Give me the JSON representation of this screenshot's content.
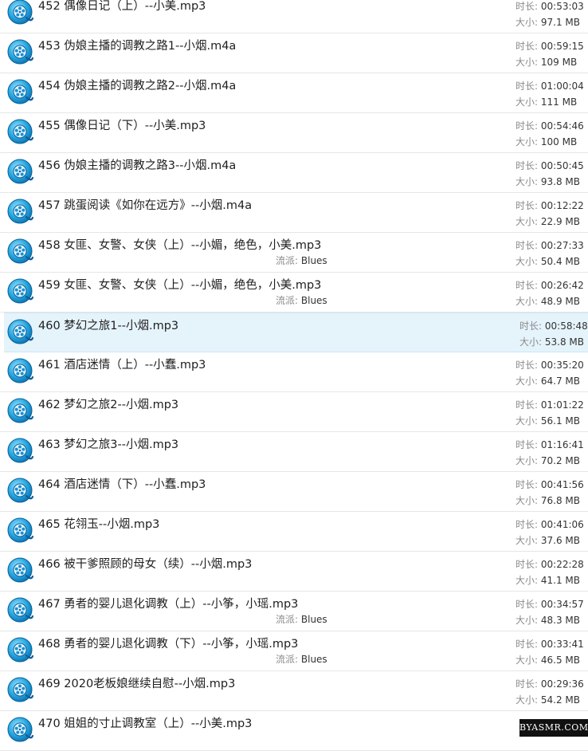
{
  "labels": {
    "duration": "时长:",
    "size": "大小:",
    "genre": "流派:"
  },
  "colors": {
    "selected_row": "#e5f3fb",
    "icon_primary": "#29a9e0",
    "icon_highlight": "#9ce4ff"
  },
  "icon": "media-player-icon",
  "items": [
    {
      "title": "452 偶像日记（上）--小美.mp3",
      "duration": "00:53:03",
      "size": "97.1 MB",
      "genre": "",
      "selected": false
    },
    {
      "title": "453 伪娘主播的调教之路1--小烟.m4a",
      "duration": "00:59:15",
      "size": "109 MB",
      "genre": "",
      "selected": false
    },
    {
      "title": "454 伪娘主播的调教之路2--小烟.m4a",
      "duration": "01:00:04",
      "size": "111 MB",
      "genre": "",
      "selected": false
    },
    {
      "title": "455 偶像日记（下）--小美.mp3",
      "duration": "00:54:46",
      "size": "100 MB",
      "genre": "",
      "selected": false
    },
    {
      "title": "456 伪娘主播的调教之路3--小烟.m4a",
      "duration": "00:50:45",
      "size": "93.8 MB",
      "genre": "",
      "selected": false
    },
    {
      "title": "457 跳蛋阅读《如你在远方》--小烟.m4a",
      "duration": "00:12:22",
      "size": "22.9 MB",
      "genre": "",
      "selected": false
    },
    {
      "title": "458 女匪、女警、女侠（上）--小媚，绝色，小美.mp3",
      "duration": "00:27:33",
      "size": "50.4 MB",
      "genre": "Blues",
      "selected": false
    },
    {
      "title": "459 女匪、女警、女侠（上）--小媚，绝色，小美.mp3",
      "duration": "00:26:42",
      "size": "48.9 MB",
      "genre": "Blues",
      "selected": false
    },
    {
      "title": "460 梦幻之旅1--小烟.mp3",
      "duration": "00:58:48",
      "size": "53.8 MB",
      "genre": "",
      "selected": true
    },
    {
      "title": "461 酒店迷情（上）--小蠢.mp3",
      "duration": "00:35:20",
      "size": "64.7 MB",
      "genre": "",
      "selected": false
    },
    {
      "title": "462 梦幻之旅2--小烟.mp3",
      "duration": "01:01:22",
      "size": "56.1 MB",
      "genre": "",
      "selected": false
    },
    {
      "title": "463 梦幻之旅3--小烟.mp3",
      "duration": "01:16:41",
      "size": "70.2 MB",
      "genre": "",
      "selected": false
    },
    {
      "title": "464 酒店迷情（下）--小蠢.mp3",
      "duration": "00:41:56",
      "size": "76.8 MB",
      "genre": "",
      "selected": false
    },
    {
      "title": "465 花翎玉--小烟.mp3",
      "duration": "00:41:06",
      "size": "37.6 MB",
      "genre": "",
      "selected": false
    },
    {
      "title": "466 被干爹照顾的母女（续）--小烟.mp3",
      "duration": "00:22:28",
      "size": "41.1 MB",
      "genre": "",
      "selected": false
    },
    {
      "title": "467 勇者的婴儿退化调教（上）--小筝，小瑶.mp3",
      "duration": "00:34:57",
      "size": "48.3 MB",
      "genre": "Blues",
      "selected": false
    },
    {
      "title": "468 勇者的婴儿退化调教（下）--小筝，小瑶.mp3",
      "duration": "00:33:41",
      "size": "46.5 MB",
      "genre": "Blues",
      "selected": false
    },
    {
      "title": "469 2020老板娘继续自慰--小烟.mp3",
      "duration": "00:29:36",
      "size": "54.2 MB",
      "genre": "",
      "selected": false
    },
    {
      "title": "470 姐姐的寸止调教室（上）--小美.mp3",
      "duration": "",
      "size": "",
      "genre": "",
      "selected": false
    }
  ],
  "watermark": "BYASMR.COM"
}
